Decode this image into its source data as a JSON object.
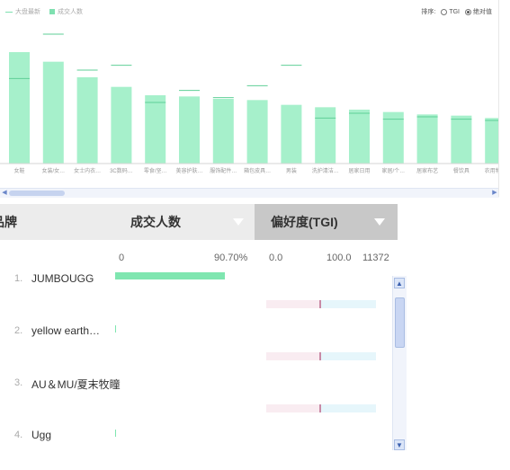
{
  "chart": {
    "legend": [
      {
        "label": "大盘最新",
        "style": "line",
        "color": "#7fe0b0"
      },
      {
        "label": "成交人数",
        "style": "box",
        "color": "#a6f0cb"
      }
    ],
    "sort_label": "排序:",
    "sort_options": [
      {
        "label": "TGI",
        "selected": false
      },
      {
        "label": "绝对值",
        "selected": true
      }
    ]
  },
  "chart_data": {
    "type": "bar",
    "categories": [
      "女鞋",
      "女装/女…",
      "女士内衣…",
      "3C数码…",
      "零食/坚…",
      "美容护肤…",
      "服饰配件…",
      "箱包皮具…",
      "男装",
      "洗护清洁…",
      "居家日用",
      "家居/个…",
      "居家布艺",
      "餐饮具",
      "农用物…"
    ],
    "series": [
      {
        "name": "成交人数",
        "values": [
          93,
          85,
          72,
          64,
          57,
          56,
          54,
          53,
          49,
          47,
          45,
          43,
          41,
          40,
          38
        ]
      },
      {
        "name": "大盘最新",
        "values": [
          71,
          108,
          78,
          82,
          51,
          61,
          55,
          65,
          82,
          38,
          42,
          37,
          39,
          37,
          36
        ]
      }
    ],
    "bar_color": "#a6f0cb",
    "line_color": "#5fcf97",
    "grid": false
  },
  "table": {
    "headers": {
      "brand": "品牌",
      "deal": "成交人数",
      "tgi": "偏好度(TGI)"
    },
    "scale": {
      "deal_min": "0",
      "deal_max": "90.70%",
      "tgi_min": "0.0",
      "tgi_mid": "100.0",
      "tgi_max": "11372"
    },
    "rows": [
      {
        "rank": "1.",
        "name": "JUMBOUGG",
        "share": 0.907
      },
      {
        "rank": "2.",
        "name": "yellow earth…",
        "share": 0.002
      },
      {
        "rank": "3.",
        "name": "AU＆MU/夏末牧瞳",
        "share": 0.0
      },
      {
        "rank": "4.",
        "name": "Ugg",
        "share": 0.002
      }
    ],
    "tgi_rows_visible": 3
  }
}
